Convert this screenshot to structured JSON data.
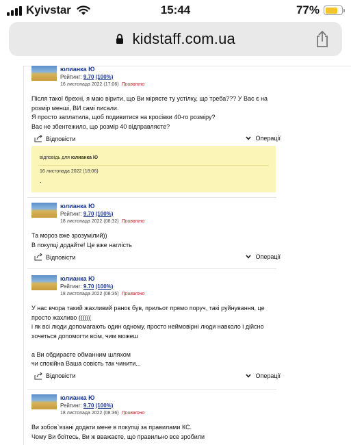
{
  "status_bar": {
    "carrier": "Kyivstar",
    "time": "15:44",
    "battery_percent": "77%",
    "battery_level": 0.77
  },
  "browser": {
    "url": "kidstaff.com.ua"
  },
  "posts": [
    {
      "author": "юлианка Ю",
      "rating_label": "Рейтинг:",
      "rating_value": "9.70",
      "rating_pct": "(100%)",
      "date": "16 листопада 2022 (17:06)",
      "private_label": "Приватно",
      "body": "Після такої брехні, я маю вірити, що Ви міряєте ту устілку, що треба??? У Вас є на розмір менші, ВИ самі писали.\nЯ просто заплатила, щоб подивитися на кросівки 40-го розміру?\nВас не збентежило, що розмір 40 відправляєте?",
      "reply_label": "Відповісти",
      "ops_label": "Операції"
    },
    {
      "author": "юлианка Ю",
      "rating_label": "Рейтинг:",
      "rating_value": "9.70",
      "rating_pct": "(100%)",
      "date": "18 листопада 2022 (08:32)",
      "private_label": "Приватно",
      "body": "Та мороз вже зрозумілий))\nВ покупці додайте! Це вже наглість",
      "reply_label": "Відповісти",
      "ops_label": "Операції"
    },
    {
      "author": "юлианка Ю",
      "rating_label": "Рейтинг:",
      "rating_value": "9.70",
      "rating_pct": "(100%)",
      "date": "18 листопада 2022 (08:35)",
      "private_label": "Приватно",
      "body": "У нас вчора такий жахливий ранок був, прильот прямо поруч, такі руйнування, це просто жахливо ((((((\nі як всі люди допомагають один одному, просто неймовірні люди навколо і дійсно хочеться допомогти всім, чим можеш\n\nа Ви обдираєте обманним шляхом\nчи спокійна Ваша совість так чинити...",
      "reply_label": "Відповісти",
      "ops_label": "Операції"
    },
    {
      "author": "юлианка Ю",
      "rating_label": "Рейтинг:",
      "rating_value": "9.70",
      "rating_pct": "(100%)",
      "date": "18 листопада 2022 (08:36)",
      "private_label": "Приватно",
      "body": "Ви зобов`язані додати мене в покупці за правилами КС.\nЧому Ви боїтесь, Ви ж вважаєте, що правильно все зробили"
    }
  ],
  "quote": {
    "prefix": "відповідь для",
    "author": "юлианка Ю",
    "date": "16 листопада 2022 (18:06)",
    "text": "."
  }
}
